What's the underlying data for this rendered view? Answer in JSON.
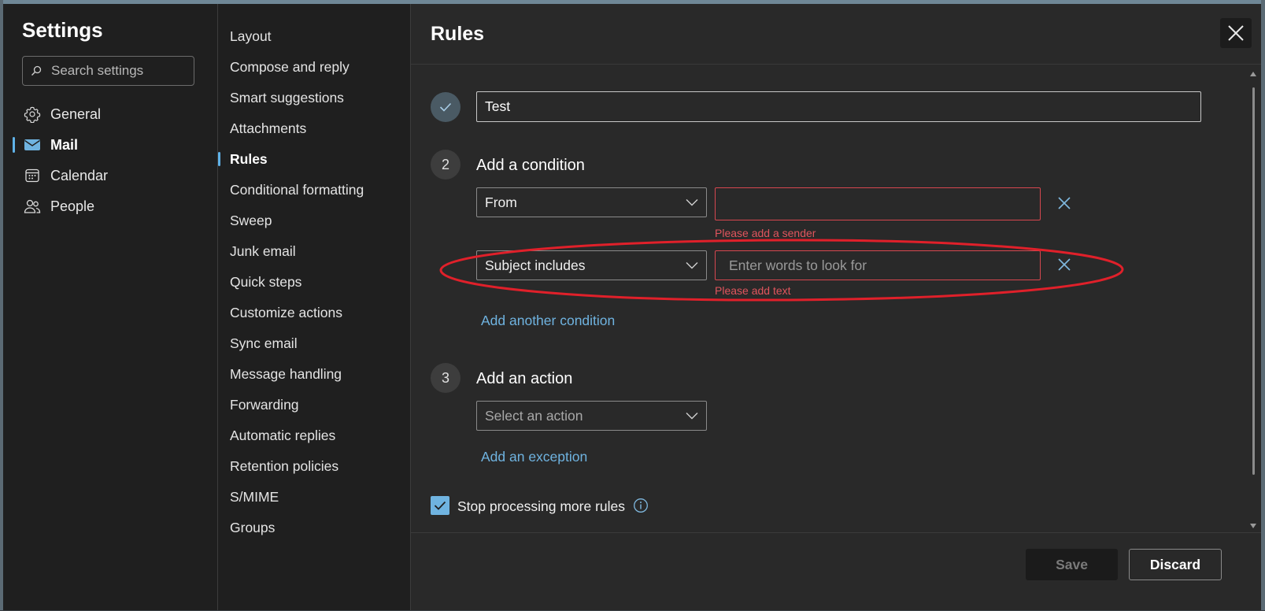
{
  "settings": {
    "title": "Settings",
    "search_placeholder": "Search settings",
    "categories": [
      {
        "label": "General",
        "icon": "gear-icon"
      },
      {
        "label": "Mail",
        "icon": "mail-icon",
        "active": true
      },
      {
        "label": "Calendar",
        "icon": "calendar-icon"
      },
      {
        "label": "People",
        "icon": "people-icon"
      }
    ]
  },
  "mail_settings": {
    "items": [
      "Layout",
      "Compose and reply",
      "Smart suggestions",
      "Attachments",
      "Rules",
      "Conditional formatting",
      "Sweep",
      "Junk email",
      "Quick steps",
      "Customize actions",
      "Sync email",
      "Message handling",
      "Forwarding",
      "Automatic replies",
      "Retention policies",
      "S/MIME",
      "Groups"
    ],
    "active": "Rules"
  },
  "rules": {
    "title": "Rules",
    "rule_name": "Test",
    "condition_step": {
      "number": "2",
      "title": "Add a condition"
    },
    "conditions": [
      {
        "type": "From",
        "value": "",
        "placeholder": "",
        "error": "Please add a sender"
      },
      {
        "type": "Subject includes",
        "value": "",
        "placeholder": "Enter words to look for",
        "error": "Please add text"
      }
    ],
    "add_condition_link": "Add another condition",
    "action_step": {
      "number": "3",
      "title": "Add an action"
    },
    "action_placeholder": "Select an action",
    "add_exception_link": "Add an exception",
    "stop_processing": {
      "label": "Stop processing more rules",
      "checked": true
    }
  },
  "footer": {
    "save_label": "Save",
    "discard_label": "Discard"
  },
  "colors": {
    "accent": "#6fb3e0",
    "error": "#d6474f",
    "annotation": "#e0202a"
  }
}
